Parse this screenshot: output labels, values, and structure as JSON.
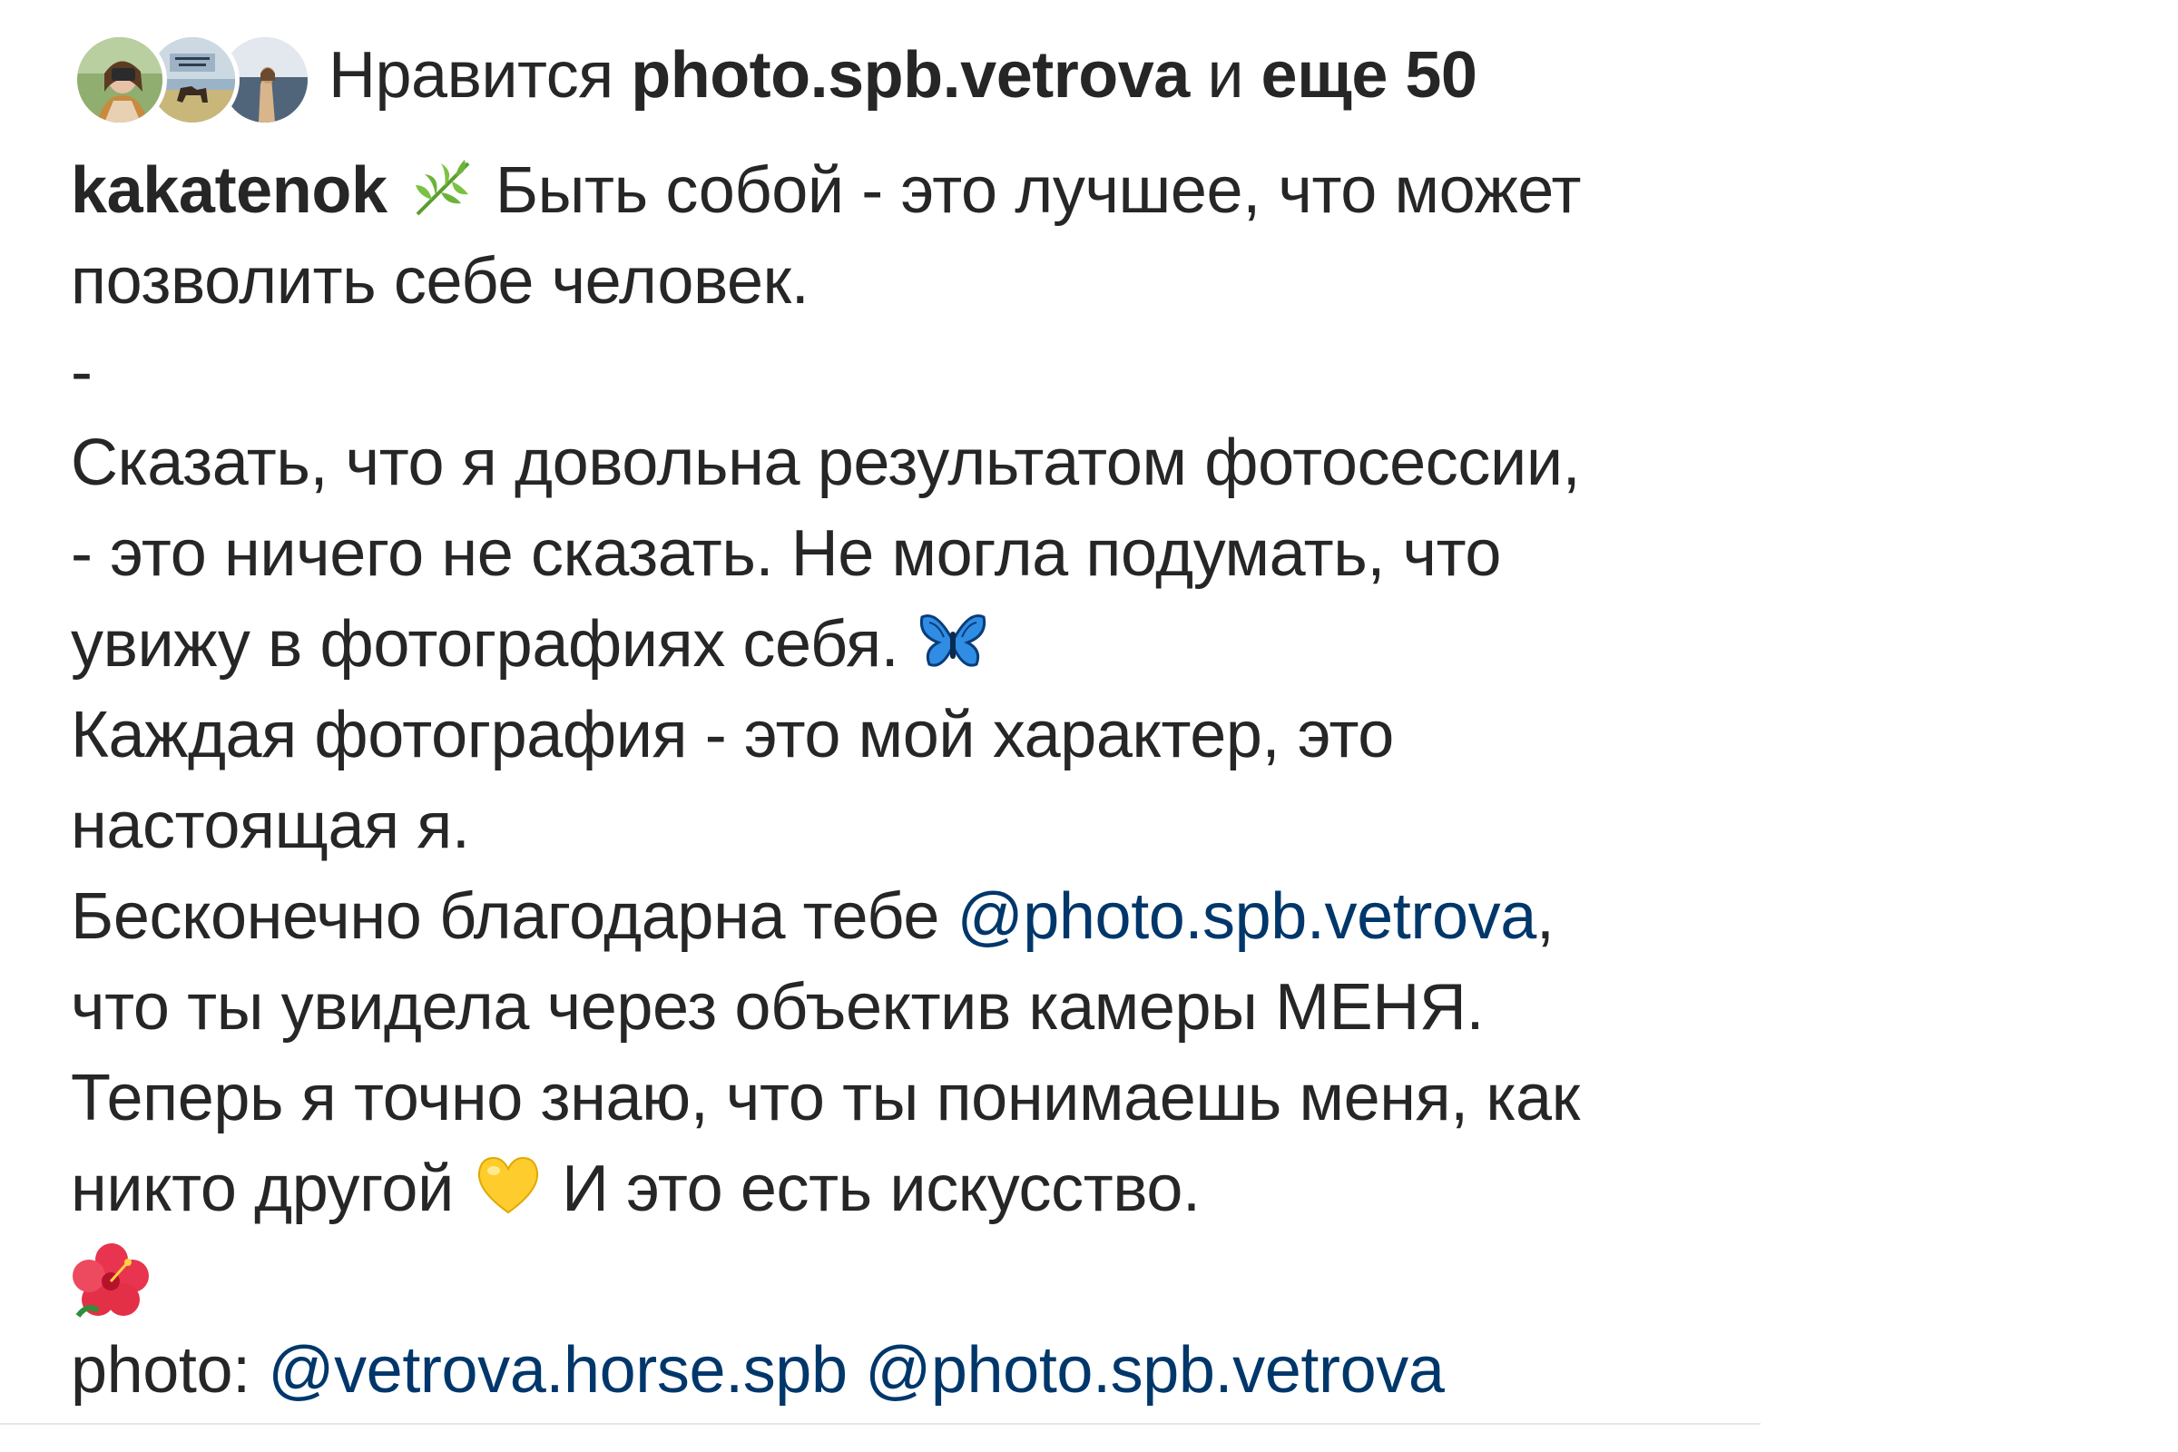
{
  "likes": {
    "prefix": "Нравится",
    "user": "photo.spb.vetrova",
    "conjunction": "и",
    "others": "еще 50",
    "avatars": [
      "avatar-photo-1",
      "avatar-photo-2",
      "avatar-photo-3"
    ]
  },
  "post": {
    "username": "kakatenok",
    "caption_lines": {
      "l1": "Быть собой - это лучшее, что может",
      "l2": "позволить себе человек.",
      "l3": "-",
      "l4": "Сказать, что я довольна результатом фотосессии,",
      "l5": "- это ничего не сказать. Не могла подумать, что",
      "l6": "увижу в фотографиях себя.",
      "l7": "Каждая фотография - это мой характер, это",
      "l8": "настоящая я.",
      "l9": "Бесконечно благодарна тебе",
      "l9_mention": "@photo.spb.vetrova",
      "l9_end": ",",
      "l10": "что ты увидела через объектив камеры МЕНЯ.",
      "l11": "Теперь я точно знаю, что ты понимаешь меня, как",
      "l12a": "никто другой",
      "l12b": "И это есть искусство.",
      "l14_prefix": "photo:",
      "l14_mention1": "@vetrova.horse.spb",
      "l14_mention2": "@photo.spb.vetrova"
    },
    "emoji": {
      "herb": "herb-emoji",
      "butterfly": "butterfly-emoji",
      "heart": "yellow-heart-emoji",
      "flower": "hibiscus-emoji"
    },
    "colors": {
      "text": "#262626",
      "mention": "#00376b"
    }
  }
}
